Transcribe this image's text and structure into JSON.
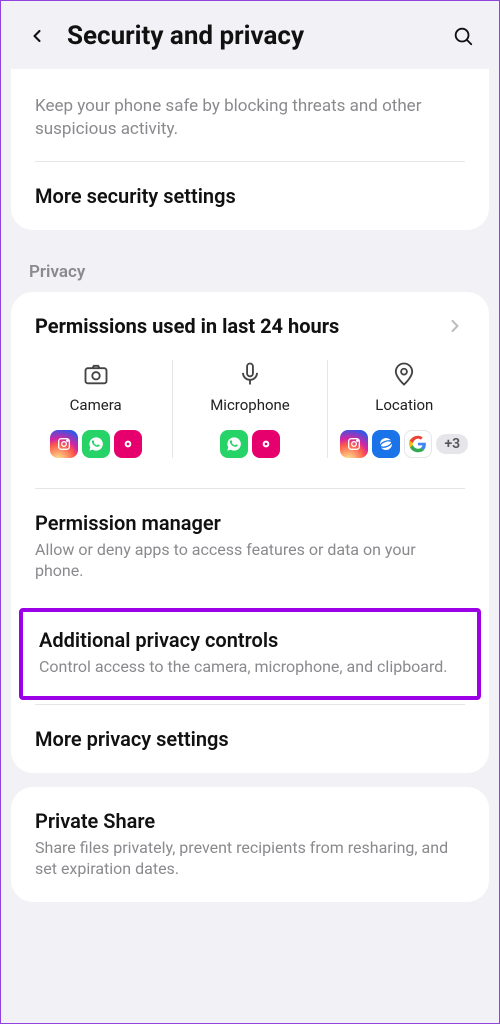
{
  "header": {
    "title": "Security and privacy"
  },
  "top_card": {
    "desc": "Keep your phone safe by blocking threats and other suspicious activity.",
    "more_security": "More security settings"
  },
  "privacy_label": "Privacy",
  "permissions": {
    "title": "Permissions used in last 24 hours",
    "cols": [
      {
        "label": "Camera"
      },
      {
        "label": "Microphone"
      },
      {
        "label": "Location"
      }
    ],
    "more_count": "+3"
  },
  "perm_manager": {
    "title": "Permission manager",
    "desc": "Allow or deny apps to access features or data on your phone."
  },
  "additional": {
    "title": "Additional privacy controls",
    "desc": "Control access to the camera, microphone, and clipboard."
  },
  "more_privacy": "More privacy settings",
  "private_share": {
    "title": "Private Share",
    "desc": "Share files privately, prevent recipients from resharing, and set expiration dates."
  }
}
